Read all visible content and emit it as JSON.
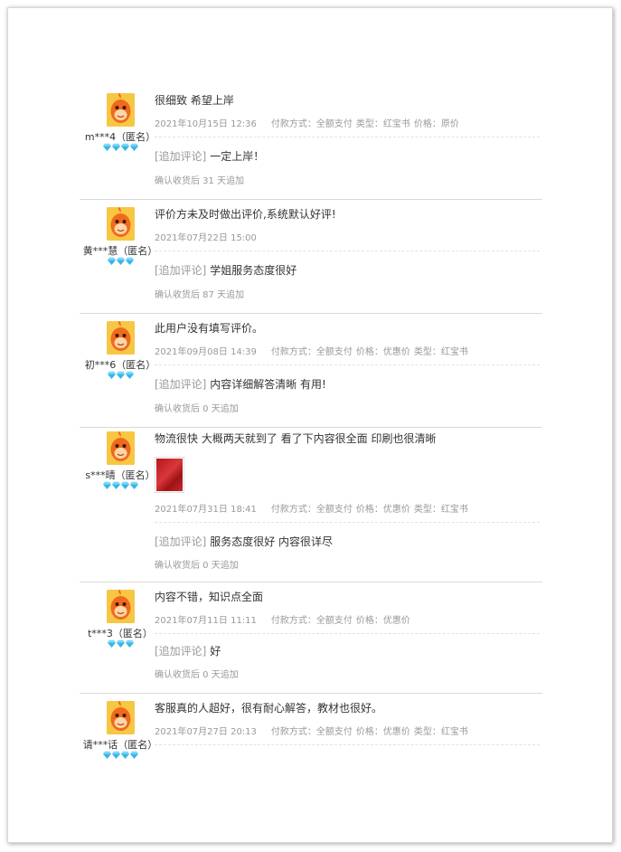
{
  "reviews": [
    {
      "user": "m***4（匿名）",
      "gems": 4,
      "text": "很细致 希望上岸",
      "date": "2021年10月15日 12:36",
      "meta": [
        "付款方式：全额支付",
        "类型：红宝书",
        "价格：原价"
      ],
      "add_tag": "[追加评论]",
      "add_text": "一定上岸！",
      "after": "确认收货后 31 天追加"
    },
    {
      "user": "黄***慧（匿名）",
      "gems": 3,
      "text": "评价方未及时做出评价,系统默认好评!",
      "date": "2021年07月22日 15:00",
      "meta": [],
      "add_tag": "[追加评论]",
      "add_text": "学姐服务态度很好",
      "after": "确认收货后 87 天追加"
    },
    {
      "user": "初***6（匿名）",
      "gems": 3,
      "text": "此用户没有填写评价。",
      "date": "2021年09月08日 14:39",
      "meta": [
        "付款方式：全额支付",
        "价格：优惠价",
        "类型：红宝书"
      ],
      "add_tag": "[追加评论]",
      "add_text": "内容详细解答清晰 有用!",
      "after": "确认收货后 0 天追加"
    },
    {
      "user": "s***晴（匿名）",
      "gems": 4,
      "text": "物流很快 大概两天就到了 看了下内容很全面 印刷也很清晰",
      "has_photo": true,
      "date": "2021年07月31日 18:41",
      "meta": [
        "付款方式：全额支付",
        "价格：优惠价",
        "类型：红宝书"
      ],
      "add_tag": "[追加评论]",
      "add_text": "服务态度很好 内容很详尽",
      "after": "确认收货后 0 天追加"
    },
    {
      "user": "t***3（匿名）",
      "gems": 3,
      "text": "内容不错，知识点全面",
      "date": "2021年07月11日 11:11",
      "meta": [
        "付款方式：全额支付",
        "价格：优惠价"
      ],
      "add_tag": "[追加评论]",
      "add_text": "好",
      "after": "确认收货后 0 天追加"
    },
    {
      "user": "请***话（匿名）",
      "gems": 4,
      "text": "客服真的人超好，很有耐心解答，教材也很好。",
      "date": "2021年07月27日 20:13",
      "meta": [
        "付款方式：全额支付",
        "价格：优惠价",
        "类型：红宝书"
      ]
    }
  ],
  "colors": {
    "gem": "#35b6e8",
    "avatar_bg": "#f7c744",
    "avatar_face": "#f06a1e"
  }
}
